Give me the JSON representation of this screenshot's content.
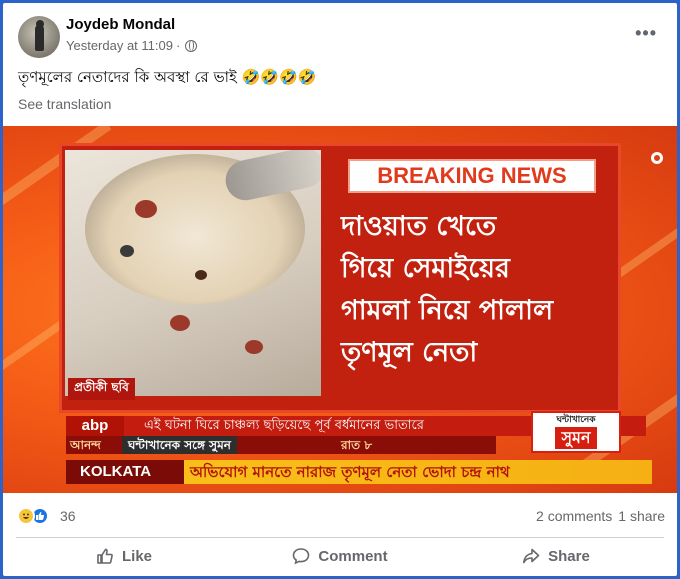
{
  "post": {
    "author": "Joydeb Mondal",
    "timestamp": "Yesterday at 11:09",
    "separator": "·",
    "audience_icon": "globe-icon",
    "more_label": "•••",
    "text": "তৃণমূলের নেতাদের কি অবস্থা রে ভাই 🤣🤣🤣🤣",
    "see_translation": "See translation"
  },
  "news_image": {
    "breaking": "BREAKING NEWS",
    "headline_lines": [
      "দাওয়াত খেতে",
      "গিয়ে সেমাইয়ের",
      "গামলা নিয়ে পালাল",
      "তৃণমূল নেতা"
    ],
    "photo_caption": "প্রতীকী ছবি",
    "channel": "abp",
    "channel_sub": "আনন্দ",
    "ticker_top": "এই ঘটনা ঘিরে চাঞ্চল্য ছড়িয়েছে পূর্ব বর্ধমানের ভাতারে",
    "show_name": "ঘন্টাখানেক সঙ্গে সুমন",
    "show_time": "রাত ৮",
    "show_logo_top": "ঘন্টাখানেক",
    "show_logo_main": "সুমন",
    "location": "KOLKATA",
    "ticker_bottom": "অভিযোগ মানতে নারাজ তৃণমূল নেতা ভোদা চন্দ্র নাথ"
  },
  "footer": {
    "reaction_count": "36",
    "comments": "2 comments",
    "shares": "1 share",
    "like_label": "Like",
    "comment_label": "Comment",
    "share_label": "Share"
  },
  "colors": {
    "page_border": "#2d63c8",
    "facebook_blue": "#1b74e4",
    "secondary_text": "#65676b",
    "news_red": "#c1210e",
    "news_orange": "#f45a16",
    "ticker_yellow": "#f9c31b"
  }
}
